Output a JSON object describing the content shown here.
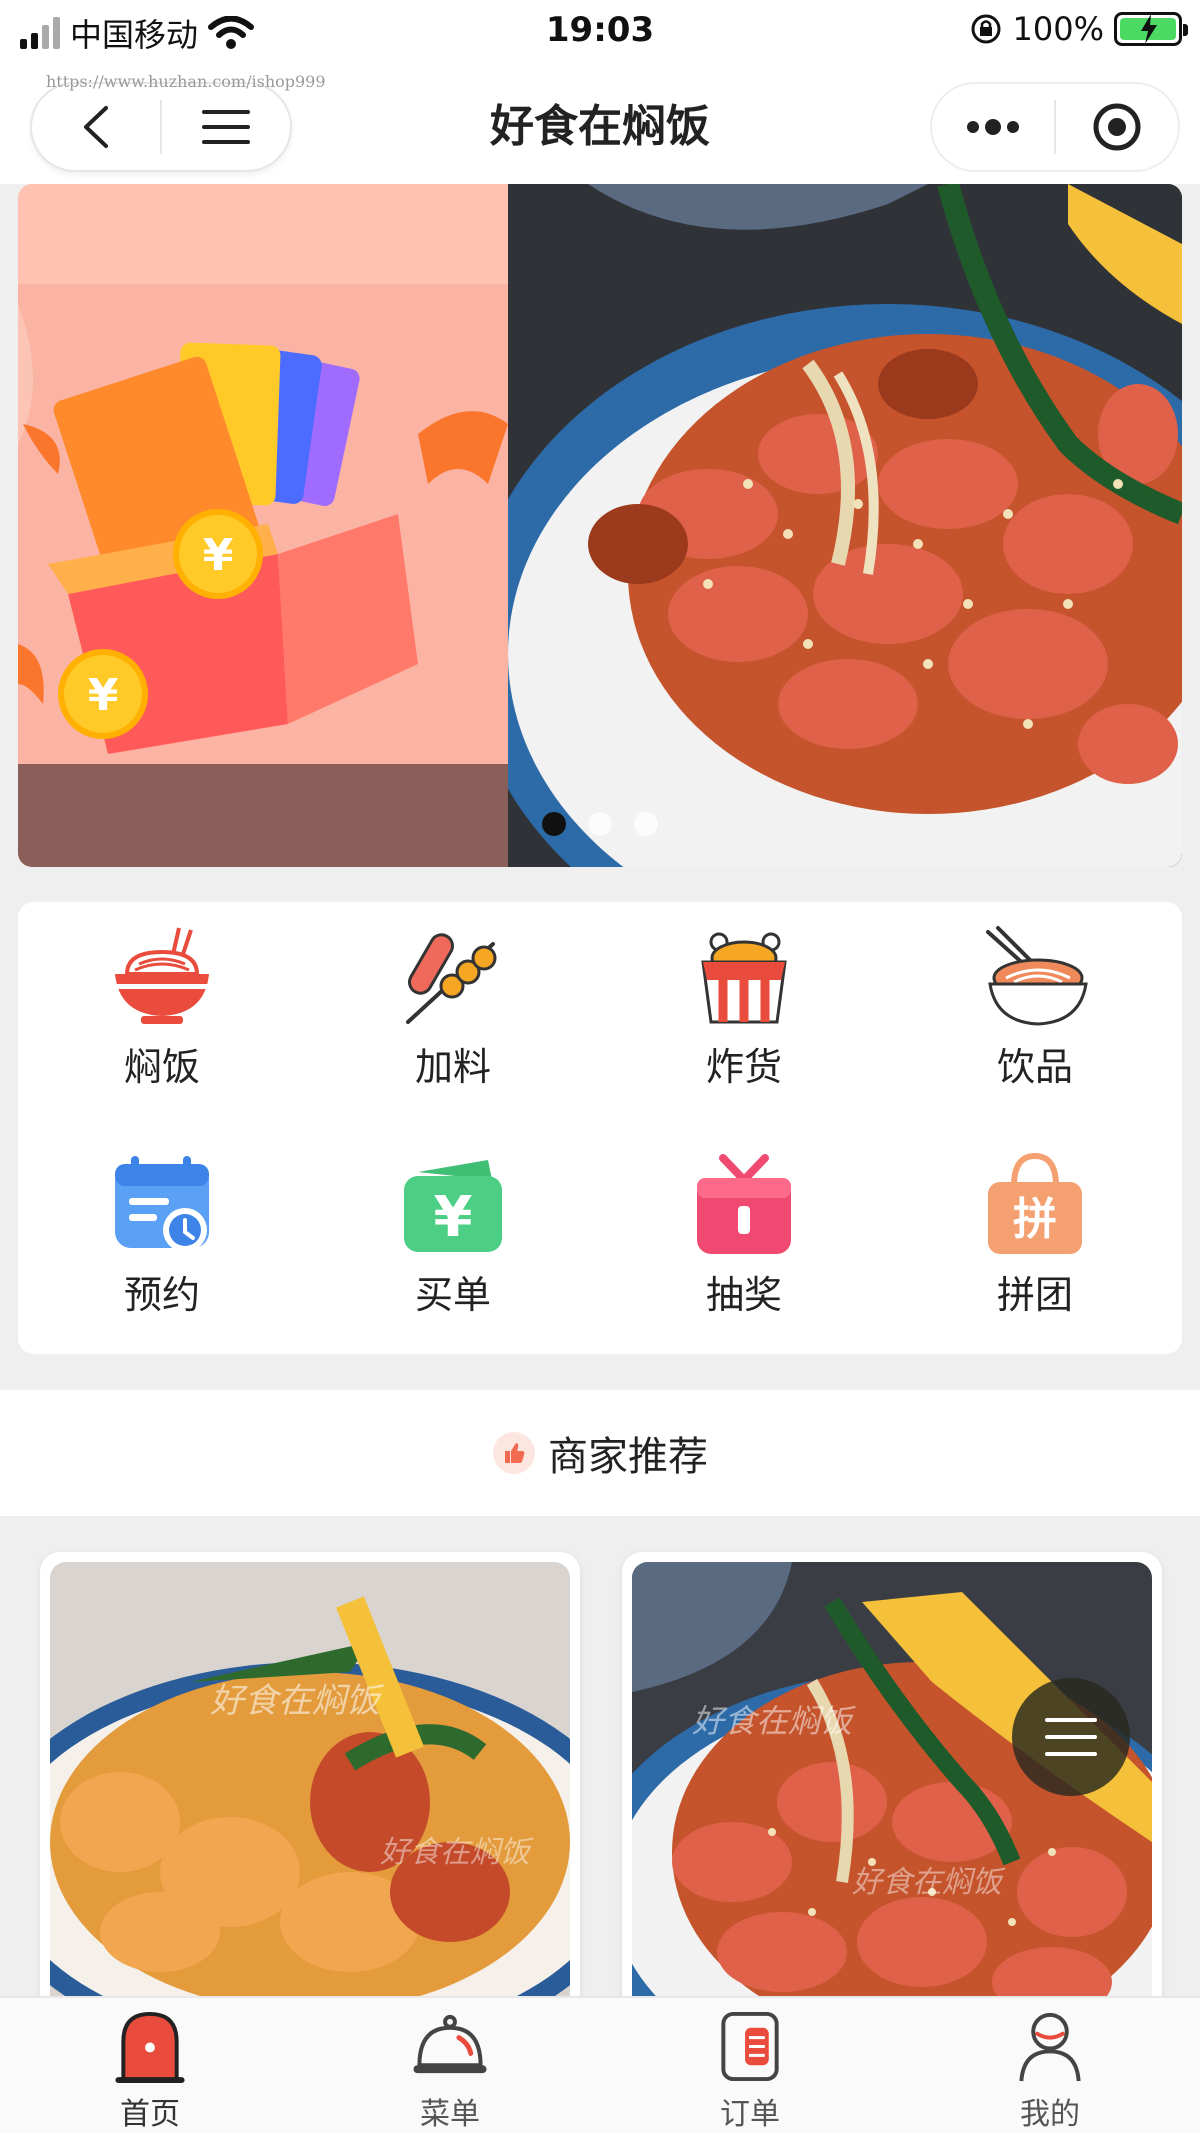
{
  "status_bar": {
    "carrier": "中国移动",
    "time": "19:03",
    "battery": "100%"
  },
  "nav": {
    "watermark": "https://www.huzhan.com/ishop999",
    "title": "好食在焖饭"
  },
  "banner": {
    "slide_count": 3,
    "active_slide": 1
  },
  "categories": [
    {
      "label": "焖饭",
      "icon": "rice-bowl-icon"
    },
    {
      "label": "加料",
      "icon": "skewer-icon"
    },
    {
      "label": "炸货",
      "icon": "fried-chicken-icon"
    },
    {
      "label": "饮品",
      "icon": "noodle-bowl-icon"
    },
    {
      "label": "预约",
      "icon": "calendar-clock-icon"
    },
    {
      "label": "买单",
      "icon": "yuan-wallet-icon"
    },
    {
      "label": "抽奖",
      "icon": "gift-icon"
    },
    {
      "label": "拼团",
      "icon": "group-buy-bag-icon"
    }
  ],
  "section": {
    "title": "商家推荐",
    "icon": "thumbs-up-icon"
  },
  "products": [
    {
      "image": "shrimp-rice-photo",
      "watermark": "好食在焖饭"
    },
    {
      "image": "sausage-rice-photo",
      "watermark": "好食在焖饭"
    }
  ],
  "tabs": [
    {
      "label": "首页",
      "icon": "home-icon",
      "active": true
    },
    {
      "label": "菜单",
      "icon": "cloche-icon",
      "active": false
    },
    {
      "label": "订单",
      "icon": "order-list-icon",
      "active": false
    },
    {
      "label": "我的",
      "icon": "person-icon",
      "active": false
    }
  ],
  "colors": {
    "accent": "#e94b3c",
    "active_dot": "#111111",
    "battery": "#4cd964"
  }
}
